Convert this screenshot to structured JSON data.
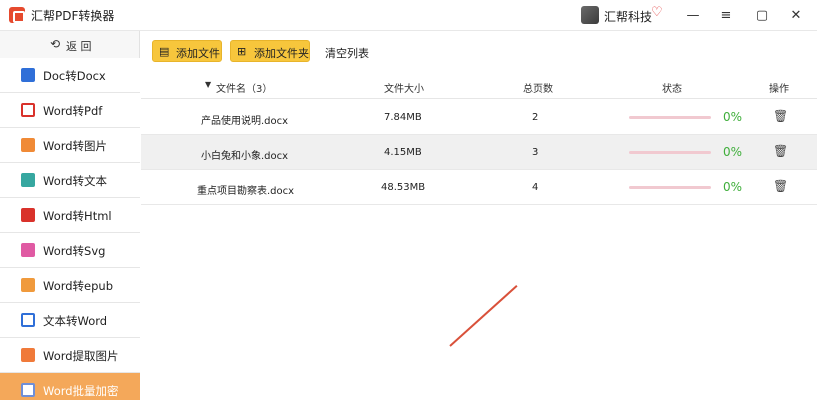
{
  "window": {
    "title": "汇帮PDF转换器",
    "brand_name": "汇帮科技",
    "brand_badge_icon": "heart-badge-icon",
    "minimize_icon": "—",
    "maximize_icon": "▢",
    "close_icon": "✕"
  },
  "sidebar": {
    "back_label": "返 回",
    "items": [
      {
        "label": "Doc转Docx",
        "icon": "doc-icon"
      },
      {
        "label": "Word转Pdf",
        "icon": "pdf-icon"
      },
      {
        "label": "Word转图片",
        "icon": "image-icon"
      },
      {
        "label": "Word转文本",
        "icon": "text-icon"
      },
      {
        "label": "Word转Html",
        "icon": "html-icon"
      },
      {
        "label": "Word转Svg",
        "icon": "svg-icon"
      },
      {
        "label": "Word转epub",
        "icon": "epub-icon"
      },
      {
        "label": "文本转Word",
        "icon": "word-icon"
      },
      {
        "label": "Word提取图片",
        "icon": "extract-image-icon"
      },
      {
        "label": "Word批量加密",
        "icon": "lock-icon",
        "active": true
      }
    ]
  },
  "toolbar": {
    "add_file_label": "添加文件",
    "add_folder_label": "添加文件夹",
    "clear_list_label": "清空列表"
  },
  "table": {
    "headers": {
      "file_name": "文件名（3）",
      "file_size": "文件大小",
      "total_pages": "总页数",
      "status": "状态",
      "action": "操作"
    },
    "rows": [
      {
        "name": "产品使用说明.docx",
        "size": "7.84MB",
        "pages": "2",
        "progress_pct": 0,
        "percent_text": "0%"
      },
      {
        "name": "小白兔和小象.docx",
        "size": "4.15MB",
        "pages": "3",
        "progress_pct": 0,
        "percent_text": "0%"
      },
      {
        "name": "重点项目勘察表.docx",
        "size": "48.53MB",
        "pages": "4",
        "progress_pct": 0,
        "percent_text": "0%"
      }
    ]
  },
  "colors": {
    "accent_button": "#f7c63c",
    "active_sidebar": "#f4a85a",
    "progress_track": "#f1c9d0",
    "percent_text": "#3fae3b"
  }
}
